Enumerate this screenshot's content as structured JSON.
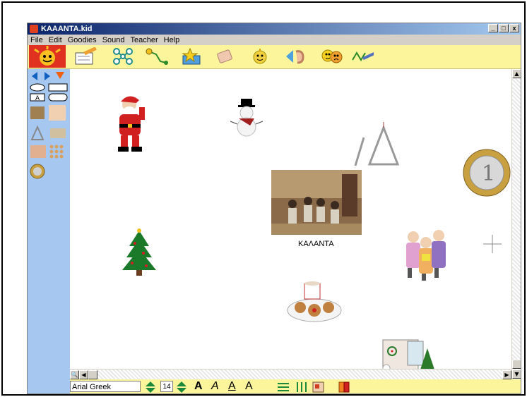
{
  "window": {
    "title": "KAAANTA.kid",
    "controls": {
      "minimize": "_",
      "maximize": "□",
      "close": "x"
    }
  },
  "menu": [
    "File",
    "Edit",
    "Goodies",
    "Sound",
    "Teacher",
    "Help"
  ],
  "toolbar": {
    "icons": [
      "pencil-notepad-icon",
      "network-diagram-icon",
      "path-icon",
      "star-box-icon",
      "eraser-icon",
      "sun-face-icon",
      "ear-icon",
      "masks-icon",
      "paintbrush-icon"
    ]
  },
  "canvas": {
    "center_caption": "ΚΑΛΑΝΤΑ"
  },
  "format_bar": {
    "font_name": "Arial Greek",
    "font_size": "14",
    "style_glyphs": [
      "A",
      "A",
      "A",
      "A"
    ]
  },
  "colors": {
    "toolbar_bg": "#fdf59b",
    "sidepanel_bg": "#a6c8f0",
    "titlebar_start": "#0a246a"
  }
}
